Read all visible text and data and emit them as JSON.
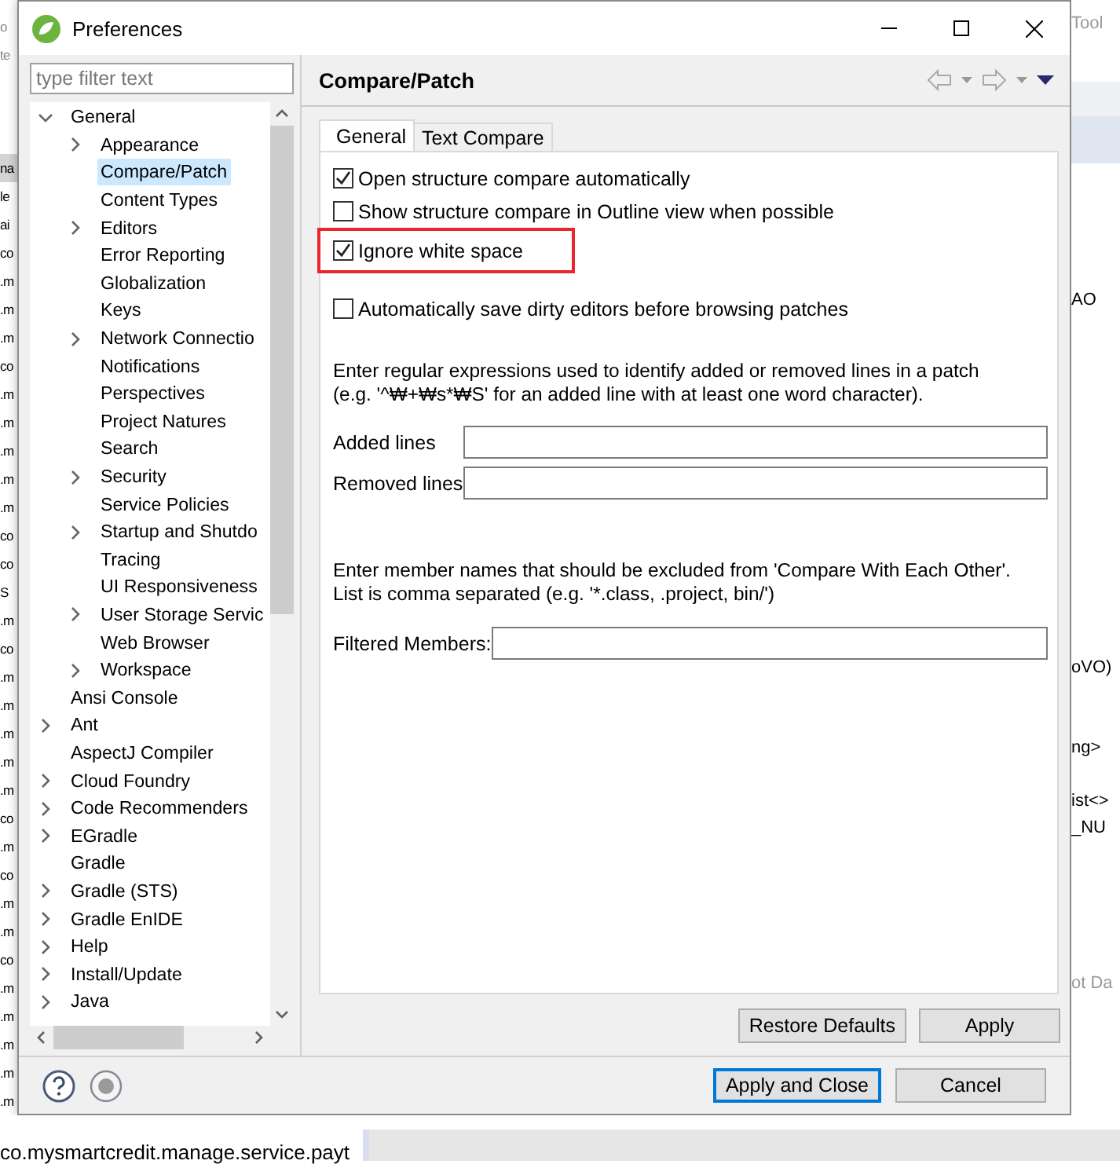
{
  "background": {
    "left_top": [
      "o",
      "te"
    ],
    "left_fragments": [
      {
        "text": "na",
        "selected": true
      },
      {
        "text": "le",
        "selected": false
      },
      {
        "text": "ai",
        "selected": false
      },
      {
        "text": "co",
        "selected": false
      },
      {
        "text": ".m",
        "selected": false
      },
      {
        "text": ".m",
        "selected": false
      },
      {
        "text": ".m",
        "selected": false
      },
      {
        "text": "co",
        "selected": false
      },
      {
        "text": ".m",
        "selected": false
      },
      {
        "text": ".m",
        "selected": false
      },
      {
        "text": ".m",
        "selected": false
      },
      {
        "text": ".m",
        "selected": false
      },
      {
        "text": ".m",
        "selected": false
      },
      {
        "text": "co",
        "selected": false
      },
      {
        "text": "co",
        "selected": false
      },
      {
        "text": "S",
        "selected": false
      },
      {
        "text": ".m",
        "selected": false
      },
      {
        "text": "co",
        "selected": false
      },
      {
        "text": ".m",
        "selected": false
      },
      {
        "text": ".m",
        "selected": false
      },
      {
        "text": ".m",
        "selected": false
      },
      {
        "text": ".m",
        "selected": false
      },
      {
        "text": ".m",
        "selected": false
      },
      {
        "text": "co",
        "selected": false
      },
      {
        "text": ".m",
        "selected": false
      },
      {
        "text": "co",
        "selected": false
      },
      {
        "text": ".m",
        "selected": false
      },
      {
        "text": ".m",
        "selected": false
      },
      {
        "text": "co",
        "selected": false
      },
      {
        "text": ".m",
        "selected": false
      },
      {
        "text": ".m",
        "selected": false
      },
      {
        "text": ".m",
        "selected": false
      },
      {
        "text": ".m",
        "selected": false
      },
      {
        "text": ".m",
        "selected": false
      }
    ],
    "right_top": "Tool",
    "right_fragments": [
      "AO",
      "oVO)",
      "ng>",
      "ist<>",
      "_NU",
      "ot Da"
    ],
    "bottom_text": "co.mysmartcredit.manage.service.payt"
  },
  "dialog": {
    "title": "Preferences"
  },
  "filter": {
    "placeholder": "type filter text"
  },
  "tree": [
    {
      "label": "General",
      "expanded": true,
      "selected": false,
      "children": [
        {
          "label": "Appearance",
          "expanded": false,
          "selected": false
        },
        {
          "label": "Compare/Patch",
          "selected": true
        },
        {
          "label": "Content Types",
          "selected": false
        },
        {
          "label": "Editors",
          "expanded": false,
          "selected": false
        },
        {
          "label": "Error Reporting",
          "selected": false
        },
        {
          "label": "Globalization",
          "selected": false
        },
        {
          "label": "Keys",
          "selected": false
        },
        {
          "label": "Network Connectio",
          "expanded": false,
          "selected": false
        },
        {
          "label": "Notifications",
          "selected": false
        },
        {
          "label": "Perspectives",
          "selected": false
        },
        {
          "label": "Project Natures",
          "selected": false
        },
        {
          "label": "Search",
          "selected": false
        },
        {
          "label": "Security",
          "expanded": false,
          "selected": false
        },
        {
          "label": "Service Policies",
          "selected": false
        },
        {
          "label": "Startup and Shutdo",
          "expanded": false,
          "selected": false
        },
        {
          "label": "Tracing",
          "selected": false
        },
        {
          "label": "UI Responsiveness",
          "selected": false
        },
        {
          "label": "User Storage Servic",
          "expanded": false,
          "selected": false
        },
        {
          "label": "Web Browser",
          "selected": false
        },
        {
          "label": "Workspace",
          "expanded": false,
          "selected": false
        }
      ]
    },
    {
      "label": "Ansi Console",
      "selected": false
    },
    {
      "label": "Ant",
      "expanded": false,
      "selected": false
    },
    {
      "label": "AspectJ Compiler",
      "selected": false
    },
    {
      "label": "Cloud Foundry",
      "expanded": false,
      "selected": false
    },
    {
      "label": "Code Recommenders",
      "expanded": false,
      "selected": false
    },
    {
      "label": "EGradle",
      "expanded": false,
      "selected": false
    },
    {
      "label": "Gradle",
      "selected": false
    },
    {
      "label": "Gradle (STS)",
      "expanded": false,
      "selected": false
    },
    {
      "label": "Gradle EnIDE",
      "expanded": false,
      "selected": false
    },
    {
      "label": "Help",
      "expanded": false,
      "selected": false
    },
    {
      "label": "Install/Update",
      "expanded": false,
      "selected": false
    },
    {
      "label": "Java",
      "expanded": false,
      "selected": false
    }
  ],
  "page": {
    "title": "Compare/Patch",
    "tabs": [
      {
        "label": "General",
        "selected": true
      },
      {
        "label": "Text Compare",
        "selected": false
      }
    ],
    "options": [
      {
        "label": "Open structure compare automatically",
        "checked": true,
        "highlighted": false
      },
      {
        "label": "Show structure compare in Outline view when possible",
        "checked": false,
        "highlighted": false
      },
      {
        "label": "Ignore white space",
        "checked": true,
        "highlighted": true
      }
    ],
    "save_option": {
      "label": "Automatically save dirty editors before browsing patches",
      "checked": false
    },
    "regex_help": [
      "Enter regular expressions used to identify added or removed lines in a patch",
      "(e.g. '^₩+₩s*₩S' for an added line with at least one word character)."
    ],
    "regex_fields": [
      {
        "label": "Added lines"
      },
      {
        "label": "Removed lines"
      }
    ],
    "filter_help": [
      "Enter member names that should be excluded from 'Compare With Each Other'.",
      "List is comma separated (e.g. '*.class, .project, bin/')"
    ],
    "filter_field": {
      "label": "Filtered Members:"
    },
    "page_buttons": [
      "Restore Defaults",
      "Apply"
    ]
  },
  "footer_buttons": [
    {
      "label": "Apply and Close",
      "default": true
    },
    {
      "label": "Cancel",
      "default": false
    }
  ]
}
